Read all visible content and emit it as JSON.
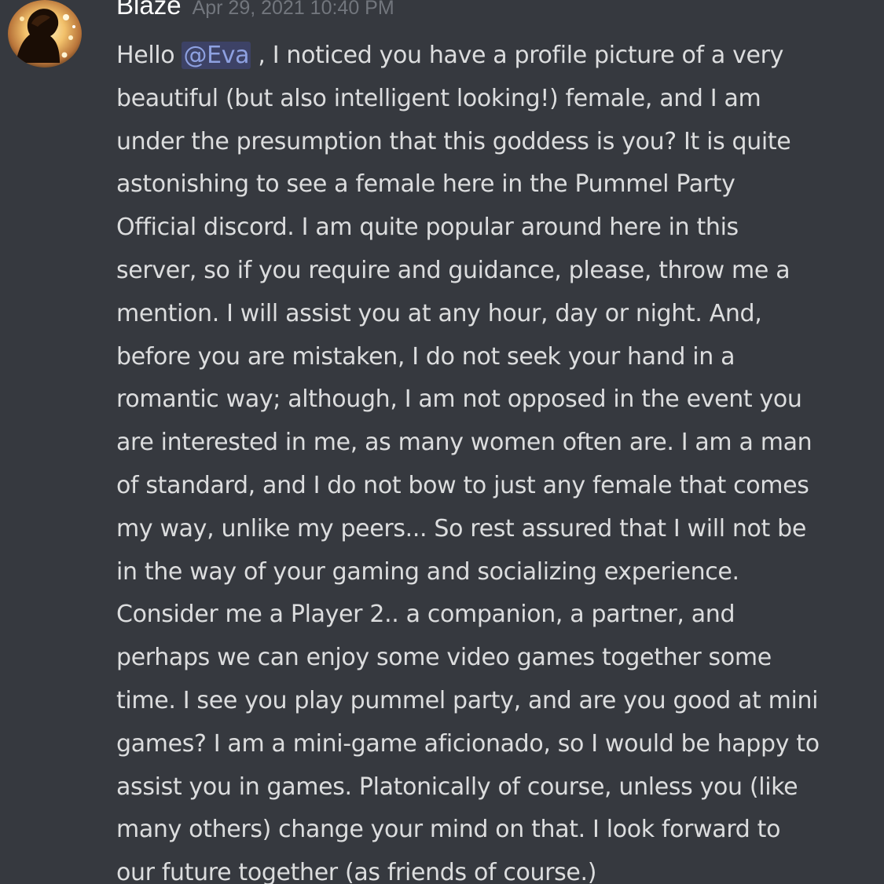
{
  "message": {
    "author": "Blaze",
    "timestamp": "Apr 29, 2021 10:40 PM",
    "avatar_icon": "user-avatar-icon",
    "colors": {
      "background": "#36393f",
      "author": "#ffffff",
      "timestamp": "#72767d",
      "text": "#dcddde",
      "mention": "#8ea1e1"
    },
    "first_line": {
      "before": "Hello ",
      "mention": "@Eva",
      "after": " , I noticed you have a profile picture of a very"
    },
    "lines": [
      "beautiful (but also intelligent looking!) female, and I am",
      "under the presumption that this goddess is you? It is quite",
      "astonishing to see a female here in the Pummel Party",
      "Official discord. I am quite popular around here in this",
      "server, so if you require and guidance, please, throw me a",
      "mention. I will assist you at any hour, day or night. And,",
      "before you are mistaken, I do not seek your hand in a",
      "romantic way; although, I am not opposed in the event you",
      "are interested in me, as many women often are. I am a man",
      "of standard, and I do not bow to just any female that comes",
      "my way, unlike my peers... So rest assured that I will not be",
      "in the way of your gaming and socializing experience.",
      "Consider me a Player 2.. a companion, a partner, and",
      "perhaps we can enjoy some video games together some",
      "time. I see you play pummel party, and are you good at mini",
      "games? I am a mini-game aficionado, so I would be happy to",
      "assist you in games. Platonically of course, unless you (like",
      "many others) change your mind on that. I look forward to",
      "our future together (as friends of course.)"
    ]
  }
}
